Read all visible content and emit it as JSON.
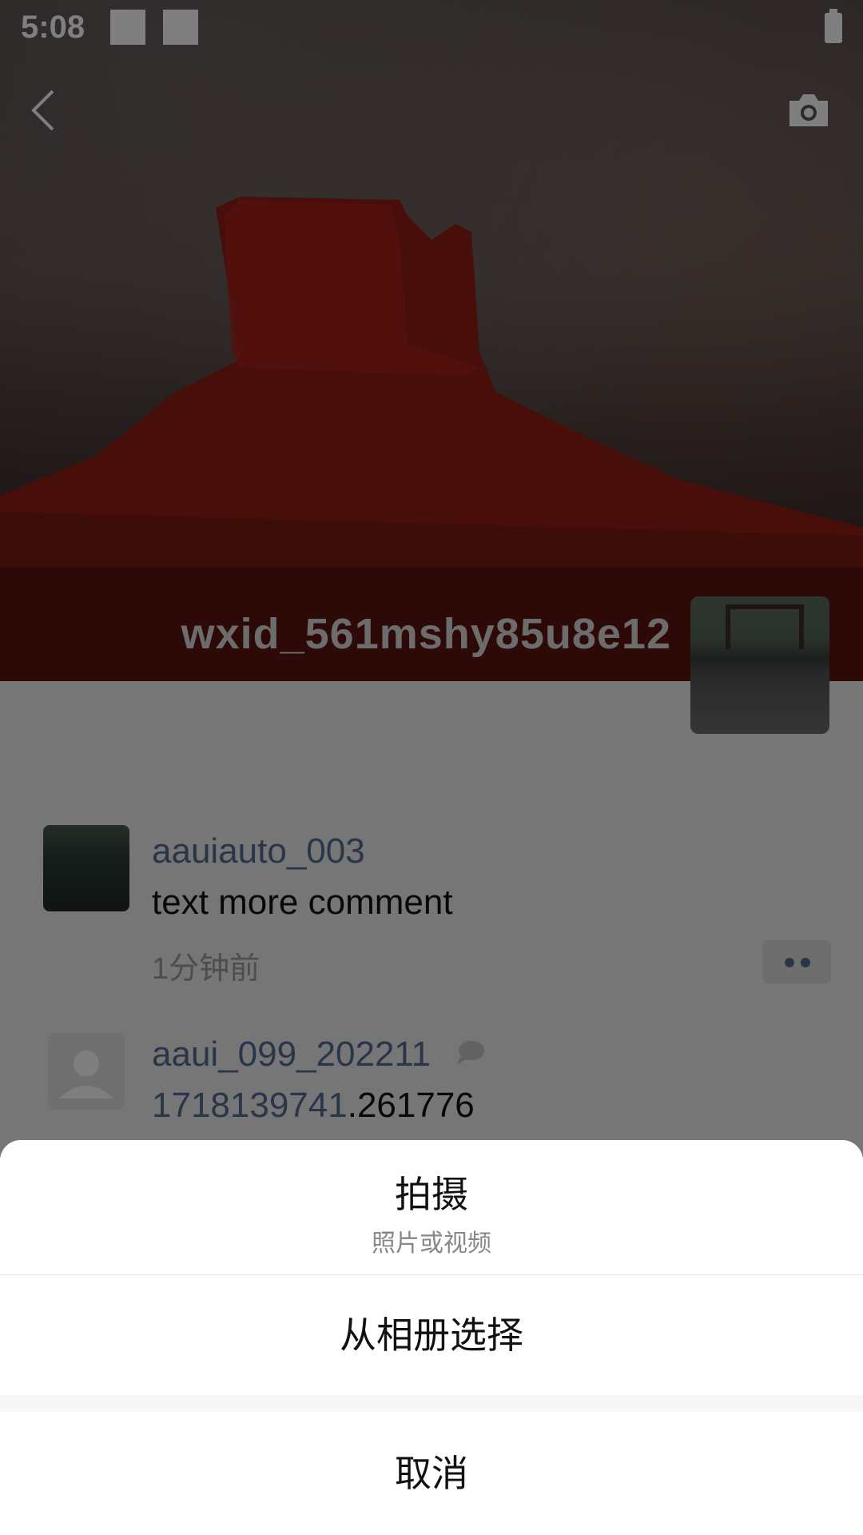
{
  "status_bar": {
    "time": "5:08"
  },
  "profile": {
    "username": "wxid_561mshy85u8e12"
  },
  "comments": [
    {
      "author": "aauiauto_003",
      "text": "text more comment",
      "time": "1分钟前"
    },
    {
      "author": "aaui_099_202211",
      "text_highlight": "1718139741",
      "text_rest": ".261776"
    }
  ],
  "action_sheet": {
    "shoot": {
      "title": "拍摄",
      "subtitle": "照片或视频"
    },
    "album": {
      "title": "从相册选择"
    },
    "cancel": {
      "title": "取消"
    }
  },
  "colors": {
    "link": "#576b95",
    "overlay": "rgba(0,0,0,0.5)",
    "sheet_bg": "#ffffff"
  },
  "icons": [
    "back-icon",
    "camera-icon",
    "battery-icon",
    "more-icon",
    "default-avatar-icon",
    "chat-bubble-icon"
  ]
}
